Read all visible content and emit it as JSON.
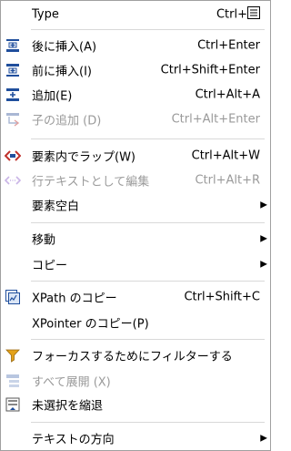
{
  "menu": {
    "type": {
      "label": "Type",
      "shortcut": "Ctrl+"
    },
    "insert_before": {
      "label": "後に挿入(A)",
      "shortcut": "Ctrl+Enter"
    },
    "insert_after": {
      "label": "前に挿入(I)",
      "shortcut": "Ctrl+Shift+Enter"
    },
    "add": {
      "label": "追加(E)",
      "shortcut": "Ctrl+Alt+A"
    },
    "add_child": {
      "label": "子の追加 (D)",
      "shortcut": "Ctrl+Alt+Enter"
    },
    "wrap_element": {
      "label": "要素内でラップ(W)",
      "shortcut": "Ctrl+Alt+W"
    },
    "edit_as_text": {
      "label": "行テキストとして編集",
      "shortcut": "Ctrl+Alt+R"
    },
    "element_blank": {
      "label": "要素空白"
    },
    "move": {
      "label": "移動"
    },
    "copy": {
      "label": "コピー"
    },
    "xpath_copy": {
      "label": "XPath のコピー",
      "shortcut": "Ctrl+Shift+C"
    },
    "xpointer_copy": {
      "label": "XPointer のコピー(P)"
    },
    "filter_focus": {
      "label": "フォーカスするためにフィルターする"
    },
    "expand_all": {
      "label": "すべて展開 (X)"
    },
    "collapse_unselected": {
      "label": "未選択を縮退"
    },
    "text_direction": {
      "label": "テキストの方向"
    }
  },
  "colors": {
    "icon_blue": "#1f4e9c",
    "icon_red": "#c0312b",
    "icon_orange": "#d89a1a",
    "disabled": "#9a9a9a",
    "separator": "#d9d9d9"
  }
}
